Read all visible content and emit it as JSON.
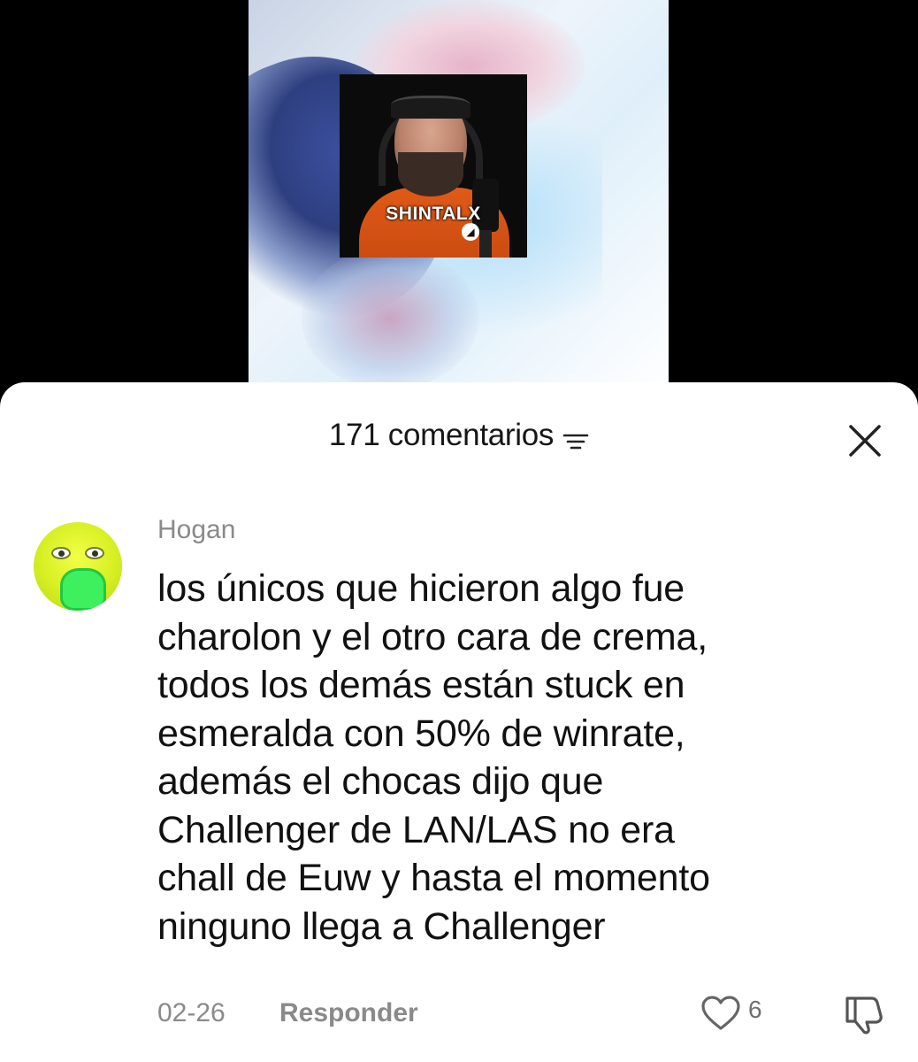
{
  "video": {
    "streamer_tag": "SHINTALX"
  },
  "comments_sheet": {
    "title": "171 comentarios"
  },
  "comment": {
    "author": "Hogan",
    "text": "los únicos que hicieron algo fue\ncharolon y el otro cara de crema,\ntodos los demás están stuck en\nesmeralda con 50% de winrate,\nademás el chocas dijo que\nChallenger de LAN/LAS no era\nchall de Euw y hasta el momento\nninguno llega a Challenger",
    "date": "02-26",
    "reply_label": "Responder",
    "like_count": "6"
  },
  "icons": {
    "filter": "filter-lines-icon",
    "close": "close-icon",
    "like": "heart-outline-icon",
    "dislike": "thumbs-down-icon"
  }
}
